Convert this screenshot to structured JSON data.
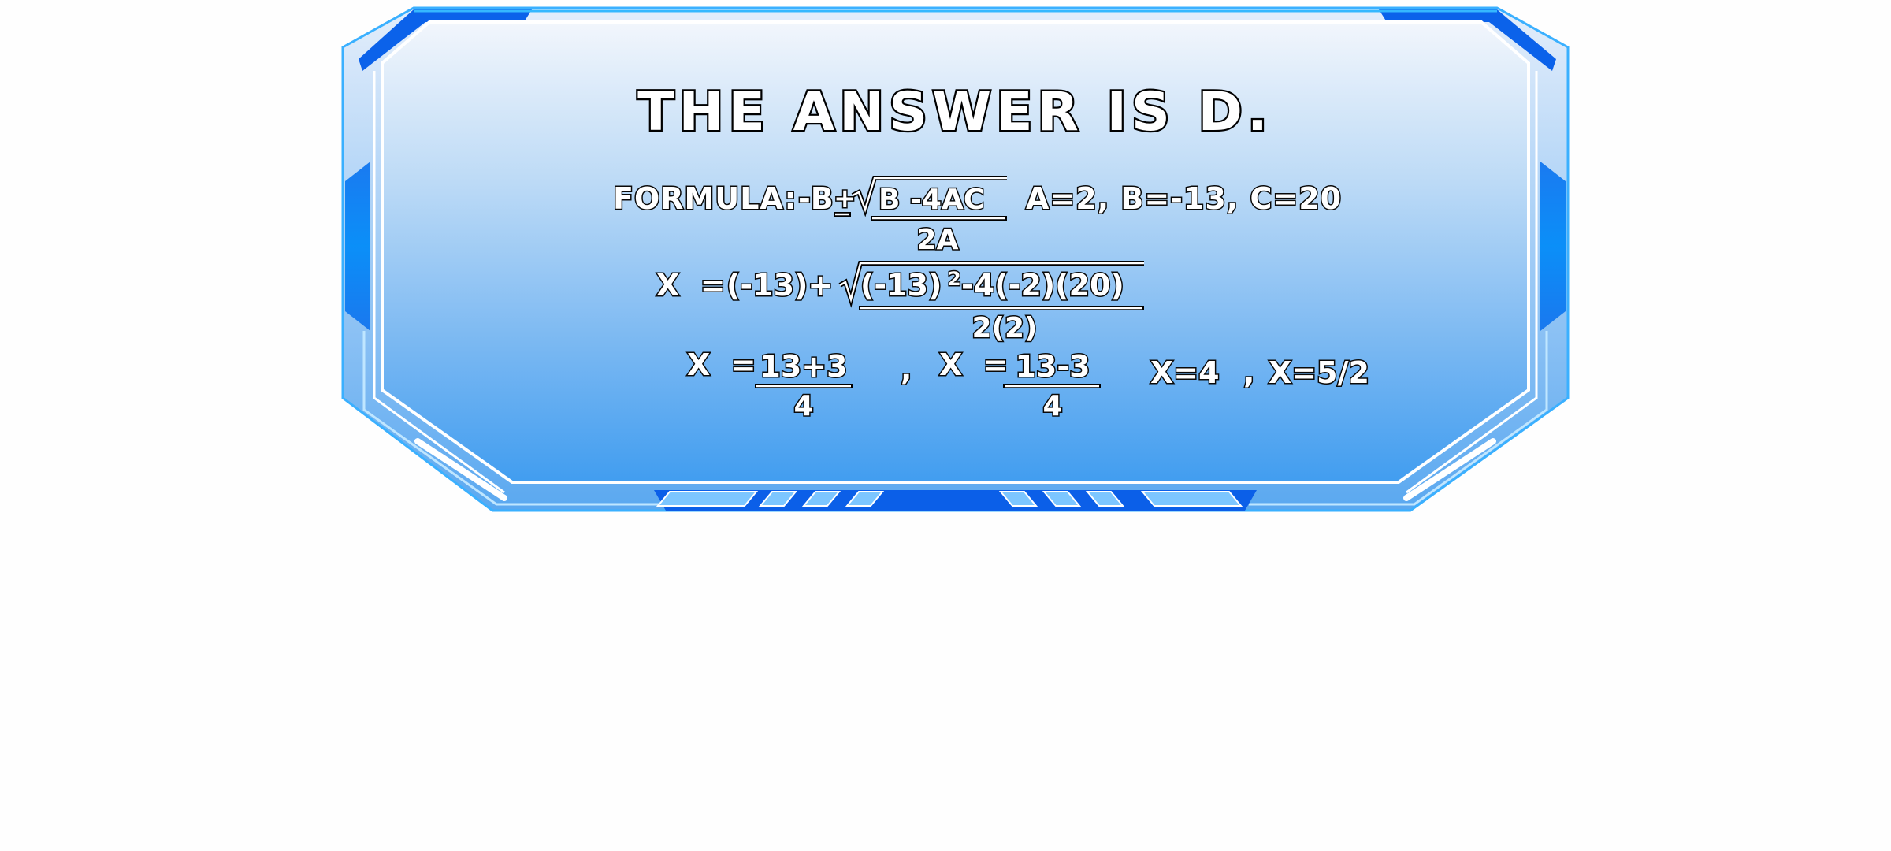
{
  "answer": {
    "title": "THE ANSWER IS D."
  },
  "formula": {
    "label": "FORMULA:",
    "numerator_prefix": "-B",
    "plus_minus": "+",
    "radicand": "B  -4AC",
    "denominator": "2A",
    "values": "A=2, B=-13, C=20"
  },
  "substitution": {
    "lhs": "X  =",
    "prefix": "(-13)+",
    "radicand_start": "(-13)",
    "exponent": "2",
    "radicand_end": "-4(-2)(20)",
    "denominator": "2(2)"
  },
  "solutions": {
    "x1_lhs": "X  =",
    "x1_numerator": "13+3",
    "x1_denominator": "4",
    "separator": ",",
    "x2_lhs": "X  =",
    "x2_numerator": "13-3",
    "x2_denominator": "4",
    "result_1": "X=4",
    "result_separator": ",",
    "result_2": "X=5/2"
  },
  "colors": {
    "panel_top": "#eef4fc",
    "panel_bottom": "#409cf0",
    "border_dark": "#0a5ee8",
    "border_light": "#5fc8ff"
  }
}
